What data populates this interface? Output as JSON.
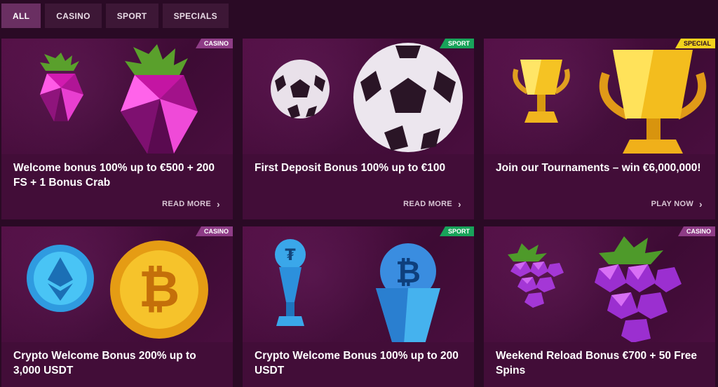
{
  "tabs": [
    {
      "label": "ALL",
      "active": true
    },
    {
      "label": "CASINO",
      "active": false
    },
    {
      "label": "SPORT",
      "active": false
    },
    {
      "label": "SPECIALS",
      "active": false
    }
  ],
  "cards": [
    {
      "badge": "CASINO",
      "badge_type": "casino",
      "title": "Welcome bonus 100% up to €500 + 200 FS + 1 Bonus Crab",
      "cta": "READ MORE",
      "icon": "raspberry-icon"
    },
    {
      "badge": "SPORT",
      "badge_type": "sport",
      "title": "First Deposit Bonus 100% up to €100",
      "cta": "READ MORE",
      "icon": "soccer-ball-icon"
    },
    {
      "badge": "SPECIAL",
      "badge_type": "special",
      "title": "Join our Tournaments – win €6,000,000!",
      "cta": "PLAY NOW",
      "icon": "trophy-icon"
    },
    {
      "badge": "CASINO",
      "badge_type": "casino",
      "title": "Crypto Welcome Bonus 200% up to 3,000 USDT",
      "cta": "",
      "icon": "crypto-coin-icon"
    },
    {
      "badge": "SPORT",
      "badge_type": "sport",
      "title": "Crypto Welcome Bonus 100% up to 200 USDT",
      "cta": "",
      "icon": "crypto-trophy-icon"
    },
    {
      "badge": "CASINO",
      "badge_type": "casino",
      "title": "Weekend Reload Bonus €700 + 50 Free Spins",
      "cta": "",
      "icon": "grapes-icon"
    }
  ],
  "colors": {
    "background": "#2a0a25",
    "card": "#420d38",
    "casino_badge": "#8e3c86",
    "sport_badge": "#18a35a",
    "special_badge": "#f2d21d"
  }
}
